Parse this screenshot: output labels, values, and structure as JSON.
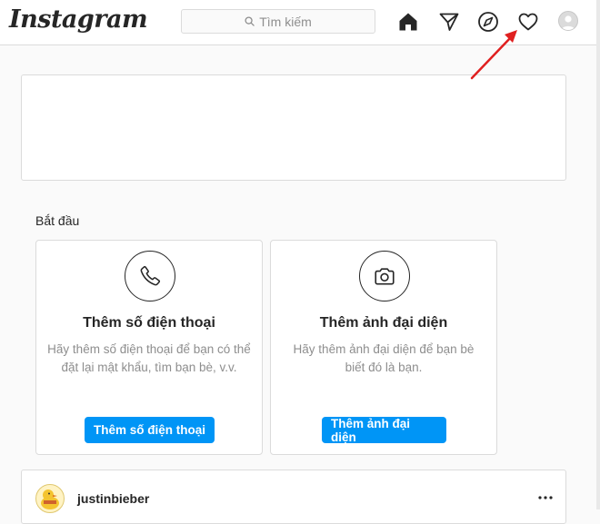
{
  "header": {
    "logo": "Instagram",
    "search": {
      "placeholder": "Tìm kiếm"
    },
    "nav_icons": [
      "home-icon",
      "direct-send-icon",
      "explore-compass-icon",
      "activity-heart-icon",
      "profile-avatar"
    ]
  },
  "getting_started": {
    "title": "Bắt đầu",
    "cards": [
      {
        "icon": "phone-icon",
        "title": "Thêm số điện thoại",
        "description": "Hãy thêm số điện thoại để bạn có thể đặt lại mật khẩu, tìm bạn bè, v.v.",
        "button": "Thêm số điện thoại"
      },
      {
        "icon": "camera-icon",
        "title": "Thêm ảnh đại diện",
        "description": "Hãy thêm ảnh đại diện để bạn bè biết đó là bạn.",
        "button": "Thêm ảnh đại diện"
      }
    ]
  },
  "feed": {
    "post": {
      "username": "justinbieber"
    }
  },
  "colors": {
    "primary_button": "#0095f6",
    "annotation_arrow": "#e02020",
    "border": "#dbdbdb",
    "muted_text": "#8e8e8e"
  }
}
